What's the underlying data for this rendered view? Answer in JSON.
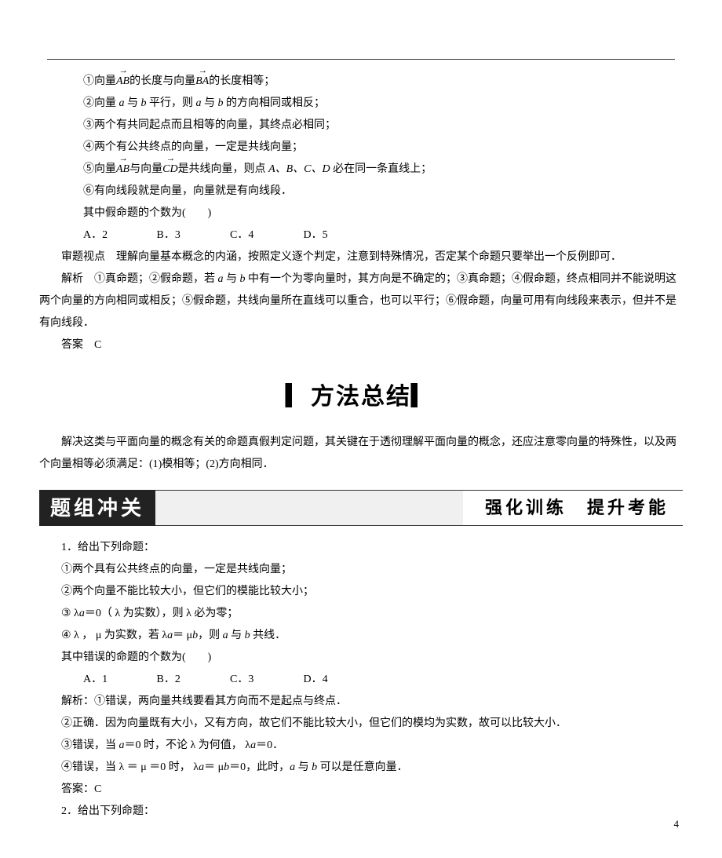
{
  "stmts1": {
    "s1a": "①向量",
    "s1b": "AB",
    "s1c": "的长度与向量",
    "s1d": "BA",
    "s1e": "的长度相等；",
    "s2a": "②向量 ",
    "s2b": "a",
    "s2c": " 与 ",
    "s2d": "b",
    "s2e": " 平行，则 ",
    "s2f": "a",
    "s2g": " 与 ",
    "s2h": "b",
    "s2i": " 的方向相同或相反；",
    "s3": "③两个有共同起点而且相等的向量，其终点必相同；",
    "s4": "④两个有公共终点的向量，一定是共线向量；",
    "s5a": "⑤向量",
    "s5b": "AB",
    "s5c": "与向量",
    "s5d": "CD",
    "s5e": "是共线向量，则点 ",
    "s5f": "A、B、C、D",
    "s5g": " 必在同一条直线上；",
    "s6": "⑥有向线段就是向量，向量就是有向线段．",
    "countQ": "其中假命题的个数为(　　)",
    "optA": "A．2",
    "optB": "B．3",
    "optC": "C．4",
    "optD": "D．5"
  },
  "analysis1_title": "审题视点　理解向量基本概念的内涵，按照定义逐个判定，注意到特殊情况，否定某个命题只要举出一个反例即可．",
  "explain1_a": "解析　①真命题；②假命题，若 ",
  "explain1_b": "a",
  "explain1_c": " 与 ",
  "explain1_d": "b",
  "explain1_e": " 中有一个为零向量时，其方向是不确定的；③真命题；④假命题，终点相同并不能说明这两个向量的方向相同或相反；⑤假命题，共线向量所在直线可以重合，也可以平行；⑥假命题，向量可用有向线段来表示，但并不是有向线段．",
  "ans1": "答案　C",
  "method_hdr": "▎方法总结▎",
  "method_body": "解决这类与平面向量的概念有关的命题真假判定问题，其关键在于透彻理解平面向量的概念，还应注意零向量的特殊性，以及两个向量相等必须满足：(1)模相等；(2)方向相同．",
  "band_left": "题组冲关",
  "band_right": "强化训练　提升考能",
  "q1": {
    "lead": "1．给出下列命题：",
    "s1": "①两个具有公共终点的向量，一定是共线向量；",
    "s2": "②两个向量不能比较大小，但它们的模能比较大小；",
    "s3a": "③ λ",
    "s3b": "a",
    "s3c": "＝0（ λ 为实数），则 λ 必为零；",
    "s4a": "④ λ ， μ 为实数，若 λ",
    "s4b": "a",
    "s4c": "＝ μ",
    "s4d": "b",
    "s4e": "，则 ",
    "s4f": "a",
    "s4g": " 与 ",
    "s4h": "b",
    "s4i": " 共线．",
    "countQ": "其中错误的命题的个数为(　　)",
    "optA": "A．1",
    "optB": "B．2",
    "optC": "C．3",
    "optD": "D．4",
    "exp1": "解析：①错误，两向量共线要看其方向而不是起点与终点．",
    "exp2": "②正确．因为向量既有大小，又有方向，故它们不能比较大小，但它们的模均为实数，故可以比较大小．",
    "exp3a": "③错误，当 ",
    "exp3b": "a",
    "exp3c": "＝0 时，不论 λ 为何值， λ",
    "exp3d": "a",
    "exp3e": "＝0．",
    "exp4a": "④错误，当  λ ＝ μ ＝0 时，  λ",
    "exp4b": "a",
    "exp4c": "＝ μ",
    "exp4d": "b",
    "exp4e": "＝0，此时，",
    "exp4f": "a",
    "exp4g": " 与 ",
    "exp4h": "b",
    "exp4i": " 可以是任意向量．",
    "ans": "答案：C"
  },
  "q2_lead": "2．给出下列命题：",
  "page_num": "4"
}
